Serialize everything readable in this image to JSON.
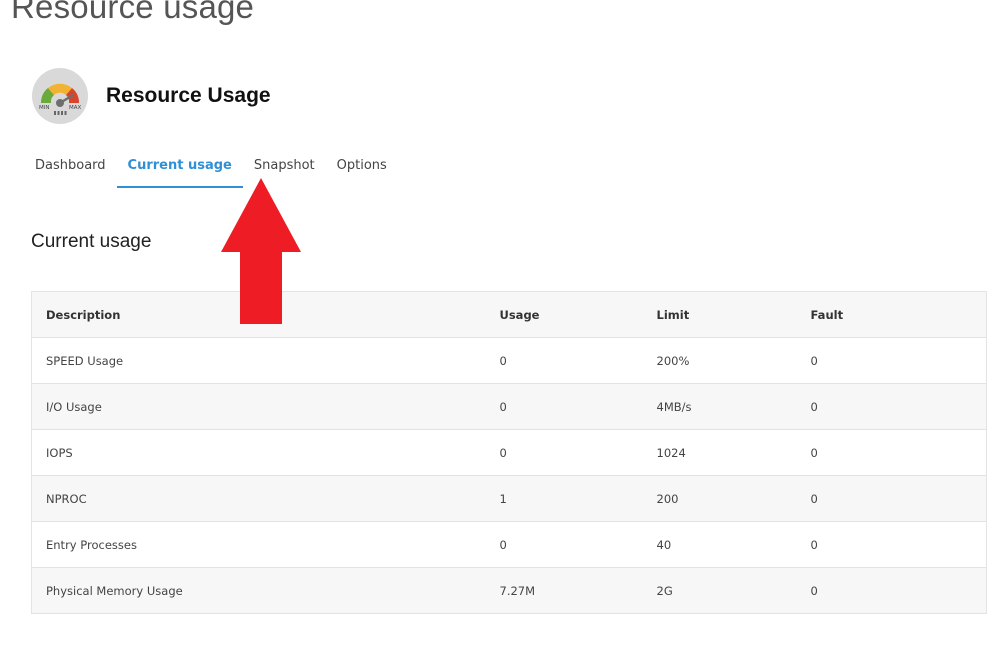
{
  "page_title": "Resource usage",
  "app": {
    "name": "Resource Usage",
    "icon": "gauge-icon"
  },
  "tabs": [
    {
      "label": "Dashboard",
      "active": false
    },
    {
      "label": "Current usage",
      "active": true
    },
    {
      "label": "Snapshot",
      "active": false
    },
    {
      "label": "Options",
      "active": false
    }
  ],
  "section_title": "Current usage",
  "table": {
    "headers": [
      "Description",
      "Usage",
      "Limit",
      "Fault"
    ],
    "rows": [
      [
        "SPEED Usage",
        "0",
        "200%",
        "0"
      ],
      [
        "I/O Usage",
        "0",
        "4MB/s",
        "0"
      ],
      [
        "IOPS",
        "0",
        "1024",
        "0"
      ],
      [
        "NPROC",
        "1",
        "200",
        "0"
      ],
      [
        "Entry Processes",
        "0",
        "40",
        "0"
      ],
      [
        "Physical Memory Usage",
        "7.27M",
        "2G",
        "0"
      ]
    ]
  },
  "gauge_labels": {
    "min": "MIN",
    "max": "MAX"
  },
  "colors": {
    "accent": "#2f8fd7",
    "arrow": "#ee1c24",
    "gauge_green": "#6aaa3a",
    "gauge_yellow": "#f2b233",
    "gauge_red": "#d9452b"
  },
  "annotation": {
    "type": "red-arrow",
    "points_to": "Snapshot"
  }
}
